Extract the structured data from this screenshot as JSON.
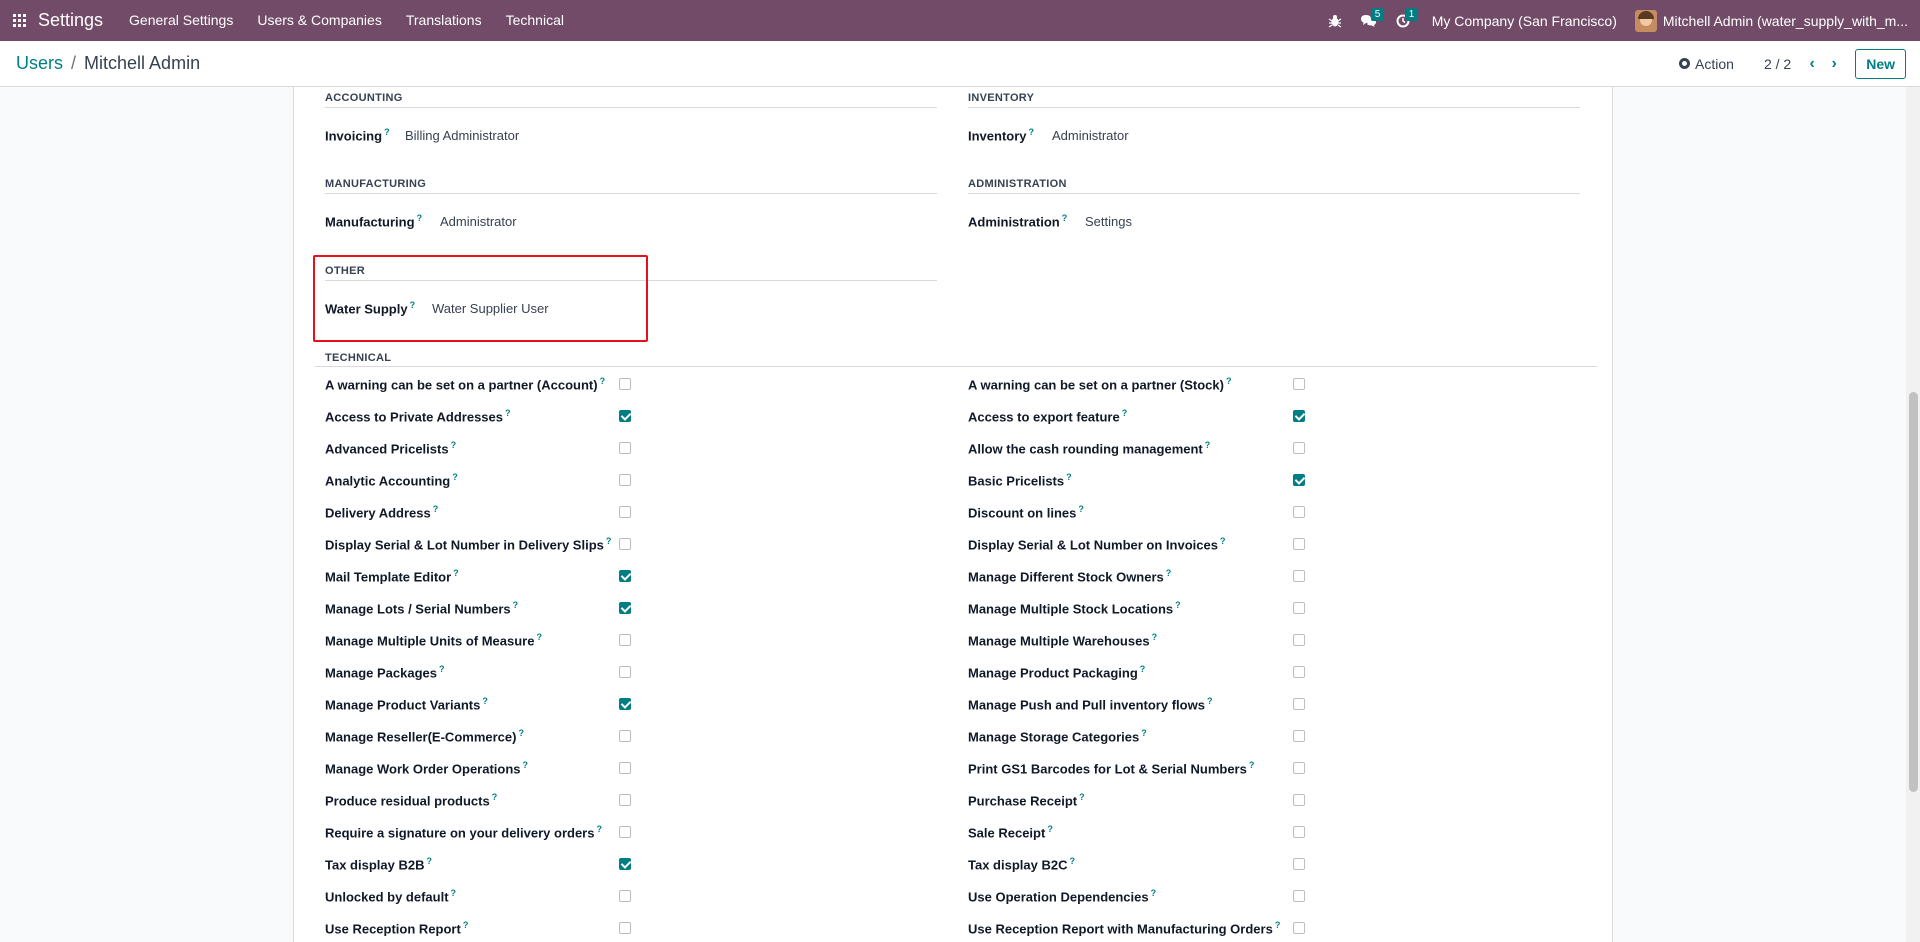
{
  "navbar": {
    "brand": "Settings",
    "menu": [
      "General Settings",
      "Users & Companies",
      "Translations",
      "Technical"
    ],
    "messages_count": "5",
    "activities_count": "1",
    "company": "My Company (San Francisco)",
    "user": "Mitchell Admin (water_supply_with_m..."
  },
  "breadcrumb": {
    "parent": "Users",
    "separator": "/",
    "current": "Mitchell Admin"
  },
  "control": {
    "action_label": "Action",
    "pager": "2 / 2",
    "new_label": "New"
  },
  "groups": {
    "accounting": {
      "title": "ACCOUNTING",
      "label": "Invoicing",
      "value": "Billing Administrator"
    },
    "inventory": {
      "title": "INVENTORY",
      "label": "Inventory",
      "value": "Administrator"
    },
    "manufacturing": {
      "title": "MANUFACTURING",
      "label": "Manufacturing",
      "value": "Administrator"
    },
    "administration": {
      "title": "ADMINISTRATION",
      "label": "Administration",
      "value": "Settings"
    },
    "other": {
      "title": "OTHER",
      "label": "Water Supply",
      "value": "Water Supplier User"
    },
    "technical": {
      "title": "TECHNICAL"
    }
  },
  "help_mark": "?",
  "technical_left": [
    {
      "label": "A warning can be set on a partner (Account)",
      "checked": false
    },
    {
      "label": "Access to Private Addresses",
      "checked": true
    },
    {
      "label": "Advanced Pricelists",
      "checked": false
    },
    {
      "label": "Analytic Accounting",
      "checked": false
    },
    {
      "label": "Delivery Address",
      "checked": false
    },
    {
      "label": "Display Serial & Lot Number in Delivery Slips",
      "checked": false
    },
    {
      "label": "Mail Template Editor",
      "checked": true
    },
    {
      "label": "Manage Lots / Serial Numbers",
      "checked": true
    },
    {
      "label": "Manage Multiple Units of Measure",
      "checked": false
    },
    {
      "label": "Manage Packages",
      "checked": false
    },
    {
      "label": "Manage Product Variants",
      "checked": true
    },
    {
      "label": "Manage Reseller(E-Commerce)",
      "checked": false
    },
    {
      "label": "Manage Work Order Operations",
      "checked": false
    },
    {
      "label": "Produce residual products",
      "checked": false
    },
    {
      "label": "Require a signature on your delivery orders",
      "checked": false
    },
    {
      "label": "Tax display B2B",
      "checked": true
    },
    {
      "label": "Unlocked by default",
      "checked": false
    },
    {
      "label": "Use Reception Report",
      "checked": false
    }
  ],
  "technical_right": [
    {
      "label": "A warning can be set on a partner (Stock)",
      "checked": false
    },
    {
      "label": "Access to export feature",
      "checked": true
    },
    {
      "label": "Allow the cash rounding management",
      "checked": false
    },
    {
      "label": "Basic Pricelists",
      "checked": true
    },
    {
      "label": "Discount on lines",
      "checked": false
    },
    {
      "label": "Display Serial & Lot Number on Invoices",
      "checked": false
    },
    {
      "label": "Manage Different Stock Owners",
      "checked": false
    },
    {
      "label": "Manage Multiple Stock Locations",
      "checked": false
    },
    {
      "label": "Manage Multiple Warehouses",
      "checked": false
    },
    {
      "label": "Manage Product Packaging",
      "checked": false
    },
    {
      "label": "Manage Push and Pull inventory flows",
      "checked": false
    },
    {
      "label": "Manage Storage Categories",
      "checked": false
    },
    {
      "label": "Print GS1 Barcodes for Lot & Serial Numbers",
      "checked": false
    },
    {
      "label": "Purchase Receipt",
      "checked": false
    },
    {
      "label": "Sale Receipt",
      "checked": false
    },
    {
      "label": "Tax display B2C",
      "checked": false
    },
    {
      "label": "Use Operation Dependencies",
      "checked": false
    },
    {
      "label": "Use Reception Report with Manufacturing Orders",
      "checked": false
    }
  ]
}
